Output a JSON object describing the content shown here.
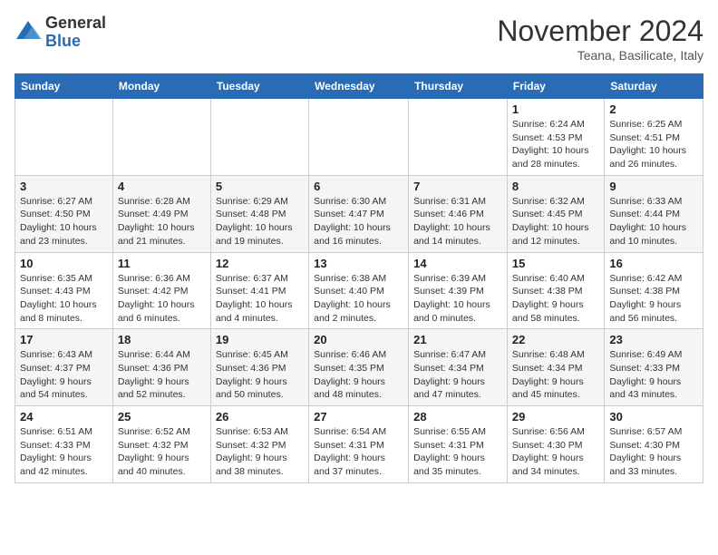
{
  "header": {
    "logo_general": "General",
    "logo_blue": "Blue",
    "month_title": "November 2024",
    "subtitle": "Teana, Basilicate, Italy"
  },
  "days_of_week": [
    "Sunday",
    "Monday",
    "Tuesday",
    "Wednesday",
    "Thursday",
    "Friday",
    "Saturday"
  ],
  "weeks": [
    [
      {
        "day": "",
        "info": ""
      },
      {
        "day": "",
        "info": ""
      },
      {
        "day": "",
        "info": ""
      },
      {
        "day": "",
        "info": ""
      },
      {
        "day": "",
        "info": ""
      },
      {
        "day": "1",
        "info": "Sunrise: 6:24 AM\nSunset: 4:53 PM\nDaylight: 10 hours and 28 minutes."
      },
      {
        "day": "2",
        "info": "Sunrise: 6:25 AM\nSunset: 4:51 PM\nDaylight: 10 hours and 26 minutes."
      }
    ],
    [
      {
        "day": "3",
        "info": "Sunrise: 6:27 AM\nSunset: 4:50 PM\nDaylight: 10 hours and 23 minutes."
      },
      {
        "day": "4",
        "info": "Sunrise: 6:28 AM\nSunset: 4:49 PM\nDaylight: 10 hours and 21 minutes."
      },
      {
        "day": "5",
        "info": "Sunrise: 6:29 AM\nSunset: 4:48 PM\nDaylight: 10 hours and 19 minutes."
      },
      {
        "day": "6",
        "info": "Sunrise: 6:30 AM\nSunset: 4:47 PM\nDaylight: 10 hours and 16 minutes."
      },
      {
        "day": "7",
        "info": "Sunrise: 6:31 AM\nSunset: 4:46 PM\nDaylight: 10 hours and 14 minutes."
      },
      {
        "day": "8",
        "info": "Sunrise: 6:32 AM\nSunset: 4:45 PM\nDaylight: 10 hours and 12 minutes."
      },
      {
        "day": "9",
        "info": "Sunrise: 6:33 AM\nSunset: 4:44 PM\nDaylight: 10 hours and 10 minutes."
      }
    ],
    [
      {
        "day": "10",
        "info": "Sunrise: 6:35 AM\nSunset: 4:43 PM\nDaylight: 10 hours and 8 minutes."
      },
      {
        "day": "11",
        "info": "Sunrise: 6:36 AM\nSunset: 4:42 PM\nDaylight: 10 hours and 6 minutes."
      },
      {
        "day": "12",
        "info": "Sunrise: 6:37 AM\nSunset: 4:41 PM\nDaylight: 10 hours and 4 minutes."
      },
      {
        "day": "13",
        "info": "Sunrise: 6:38 AM\nSunset: 4:40 PM\nDaylight: 10 hours and 2 minutes."
      },
      {
        "day": "14",
        "info": "Sunrise: 6:39 AM\nSunset: 4:39 PM\nDaylight: 10 hours and 0 minutes."
      },
      {
        "day": "15",
        "info": "Sunrise: 6:40 AM\nSunset: 4:38 PM\nDaylight: 9 hours and 58 minutes."
      },
      {
        "day": "16",
        "info": "Sunrise: 6:42 AM\nSunset: 4:38 PM\nDaylight: 9 hours and 56 minutes."
      }
    ],
    [
      {
        "day": "17",
        "info": "Sunrise: 6:43 AM\nSunset: 4:37 PM\nDaylight: 9 hours and 54 minutes."
      },
      {
        "day": "18",
        "info": "Sunrise: 6:44 AM\nSunset: 4:36 PM\nDaylight: 9 hours and 52 minutes."
      },
      {
        "day": "19",
        "info": "Sunrise: 6:45 AM\nSunset: 4:36 PM\nDaylight: 9 hours and 50 minutes."
      },
      {
        "day": "20",
        "info": "Sunrise: 6:46 AM\nSunset: 4:35 PM\nDaylight: 9 hours and 48 minutes."
      },
      {
        "day": "21",
        "info": "Sunrise: 6:47 AM\nSunset: 4:34 PM\nDaylight: 9 hours and 47 minutes."
      },
      {
        "day": "22",
        "info": "Sunrise: 6:48 AM\nSunset: 4:34 PM\nDaylight: 9 hours and 45 minutes."
      },
      {
        "day": "23",
        "info": "Sunrise: 6:49 AM\nSunset: 4:33 PM\nDaylight: 9 hours and 43 minutes."
      }
    ],
    [
      {
        "day": "24",
        "info": "Sunrise: 6:51 AM\nSunset: 4:33 PM\nDaylight: 9 hours and 42 minutes."
      },
      {
        "day": "25",
        "info": "Sunrise: 6:52 AM\nSunset: 4:32 PM\nDaylight: 9 hours and 40 minutes."
      },
      {
        "day": "26",
        "info": "Sunrise: 6:53 AM\nSunset: 4:32 PM\nDaylight: 9 hours and 38 minutes."
      },
      {
        "day": "27",
        "info": "Sunrise: 6:54 AM\nSunset: 4:31 PM\nDaylight: 9 hours and 37 minutes."
      },
      {
        "day": "28",
        "info": "Sunrise: 6:55 AM\nSunset: 4:31 PM\nDaylight: 9 hours and 35 minutes."
      },
      {
        "day": "29",
        "info": "Sunrise: 6:56 AM\nSunset: 4:30 PM\nDaylight: 9 hours and 34 minutes."
      },
      {
        "day": "30",
        "info": "Sunrise: 6:57 AM\nSunset: 4:30 PM\nDaylight: 9 hours and 33 minutes."
      }
    ]
  ]
}
